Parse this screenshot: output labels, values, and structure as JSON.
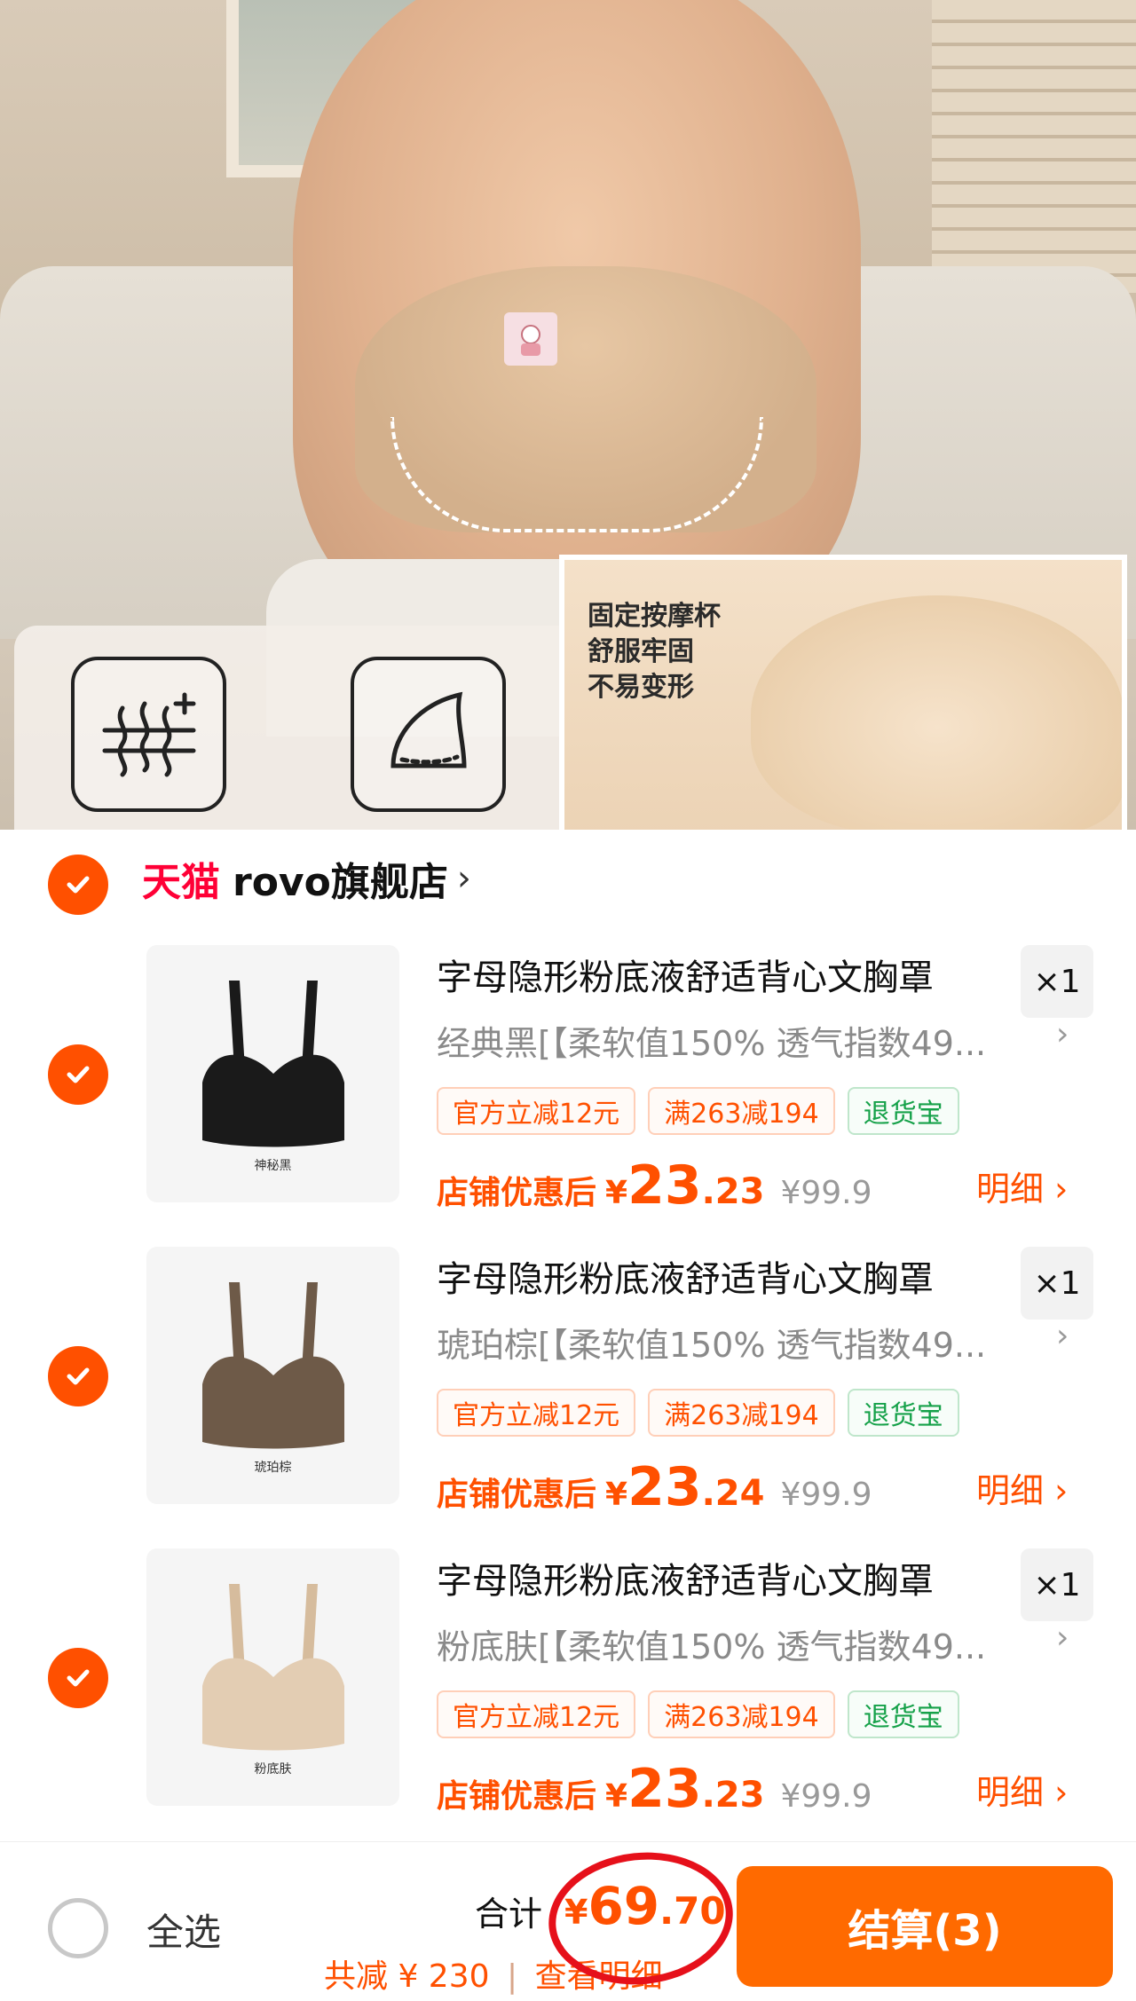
{
  "hero": {
    "inset_lines": [
      "固定按摩杯",
      "舒服牢固",
      "不易变形"
    ],
    "feature_icons": [
      "breathable-wave-icon",
      "cup-shape-icon"
    ]
  },
  "store": {
    "brand": "天猫",
    "name": "rovo旗舰店",
    "chevron": "›",
    "checked": true
  },
  "items": [
    {
      "title": "字母隐形粉底液舒适背心文胸罩",
      "quantity": "×1",
      "sku": "经典黑[【柔软值150% 透气指数49...",
      "thumb_label": "神秘黑",
      "thumb_color": "#1a1a1a",
      "tags": [
        "官方立减12元",
        "满263减194",
        "退货宝"
      ],
      "price_label": "店铺优惠后",
      "price_symbol": "¥",
      "price_int": "23",
      "price_dec": ".23",
      "original_price": "¥99.9",
      "detail": "明细 ›",
      "checked": true
    },
    {
      "title": "字母隐形粉底液舒适背心文胸罩",
      "quantity": "×1",
      "sku": "琥珀棕[【柔软值150% 透气指数49...",
      "thumb_label": "琥珀棕",
      "thumb_color": "#6e5a48",
      "tags": [
        "官方立减12元",
        "满263减194",
        "退货宝"
      ],
      "price_label": "店铺优惠后",
      "price_symbol": "¥",
      "price_int": "23",
      "price_dec": ".24",
      "original_price": "¥99.9",
      "detail": "明细 ›",
      "checked": true
    },
    {
      "title": "字母隐形粉底液舒适背心文胸罩",
      "quantity": "×1",
      "sku": "粉底肤[【柔软值150% 透气指数49...",
      "thumb_label": "粉底肤",
      "thumb_color": "#e3cdb3",
      "tags": [
        "官方立减12元",
        "满263减194",
        "退货宝"
      ],
      "price_label": "店铺优惠后",
      "price_symbol": "¥",
      "price_int": "23",
      "price_dec": ".23",
      "original_price": "¥99.9",
      "detail": "明细 ›",
      "checked": true
    }
  ],
  "bottom": {
    "select_all": "全选",
    "select_all_checked": false,
    "total_label": "合计",
    "total_symbol": "¥",
    "total_int": "69",
    "total_dec": ".70",
    "saving_text": "共减 ¥ 230",
    "separator": "|",
    "view_detail": "查看明细",
    "checkout": "结算(3)"
  },
  "colors": {
    "accent": "#ff5000",
    "checkout_bg": "#ff6a00",
    "tmall_red": "#ff0036",
    "green_tag": "#15a149",
    "annotation_red": "#e6101a"
  }
}
